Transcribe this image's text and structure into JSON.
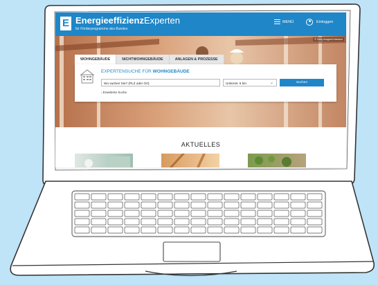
{
  "header": {
    "logo_letter": "E",
    "brand_bold": "Energieeffizienz",
    "brand_light": "Experten",
    "brand_sub": "für Förderprogramme des Bundes",
    "menu_label": "MENÜ",
    "login_label": "Einloggen"
  },
  "hero": {
    "image_credit": "© Getty Images/Collection"
  },
  "tabs": [
    {
      "label": "WOHNGEBÄUDE",
      "active": true
    },
    {
      "label": "NICHTWOHNGEBÄUDE",
      "active": false
    },
    {
      "label": "ANLAGEN & PROZESSE",
      "active": false
    }
  ],
  "search": {
    "title_prefix": "EXPERTENSUCHE FÜR",
    "title_highlight": "WOHNGEBÄUDE",
    "location_placeholder": "Wo suchen Sie? (PLZ oder Ort)",
    "radius_value": "Umkreis: 5 km",
    "search_button": "Suchen",
    "advanced_link": "Erweiterte Suche"
  },
  "news": {
    "heading": "AKTUELLES"
  },
  "colors": {
    "brand_blue": "#1f86c8",
    "background": "#bfe3f7"
  }
}
